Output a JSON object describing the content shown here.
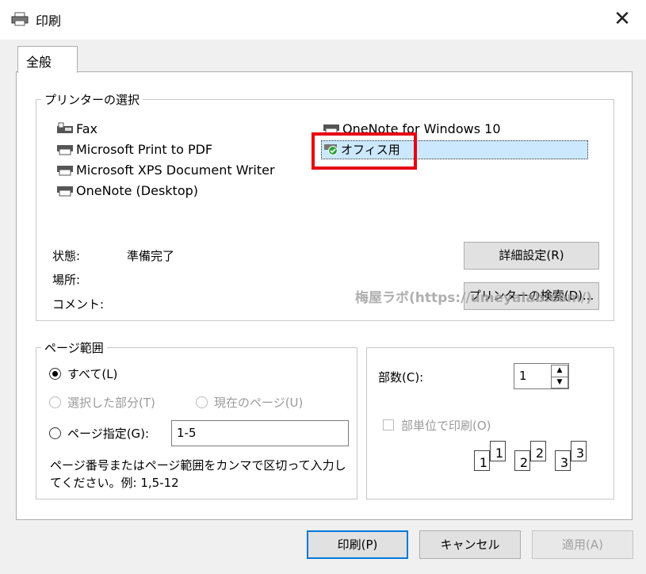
{
  "window": {
    "title": "印刷",
    "close_icon": "close-icon"
  },
  "tab": {
    "label": "全般"
  },
  "printer_select": {
    "legend": "プリンターの選択",
    "printers": [
      {
        "name": "Fax",
        "icon": "fax-icon"
      },
      {
        "name": "Microsoft Print to PDF",
        "icon": "printer-icon"
      },
      {
        "name": "Microsoft XPS Document Writer",
        "icon": "printer-icon"
      },
      {
        "name": "OneNote (Desktop)",
        "icon": "printer-icon"
      },
      {
        "name": "OneNote for Windows 10",
        "icon": "printer-icon"
      },
      {
        "name": "オフィス用",
        "icon": "default-printer-check-icon",
        "selected": true
      }
    ],
    "status_label": "状態:",
    "status_value": "準備完了",
    "location_label": "場所:",
    "comment_label": "コメント:",
    "preferences_button": "詳細設定(R)",
    "find_printer_button": "プリンターの検索(D)..."
  },
  "watermark": "梅屋ラボ(https://umeyalab.com/)",
  "page_range": {
    "legend": "ページ範囲",
    "all": "すべて(L)",
    "selection": "選択した部分(T)",
    "current_page": "現在のページ(U)",
    "pages": "ページ指定(G):",
    "pages_value": "1-5",
    "hint": "ページ番号またはページ範囲をカンマで区切って入力してください。例: 1,5-12"
  },
  "copies": {
    "label": "部数(C):",
    "value": "1",
    "collate": "部単位で印刷(O)",
    "collate_numbers": [
      "1",
      "1",
      "2",
      "2",
      "3",
      "3"
    ]
  },
  "buttons": {
    "print": "印刷(P)",
    "cancel": "キャンセル",
    "apply": "適用(A)"
  },
  "colors": {
    "selection": "#cce8ff",
    "highlight_box": "#e60012",
    "default_button_border": "#0078d7"
  }
}
